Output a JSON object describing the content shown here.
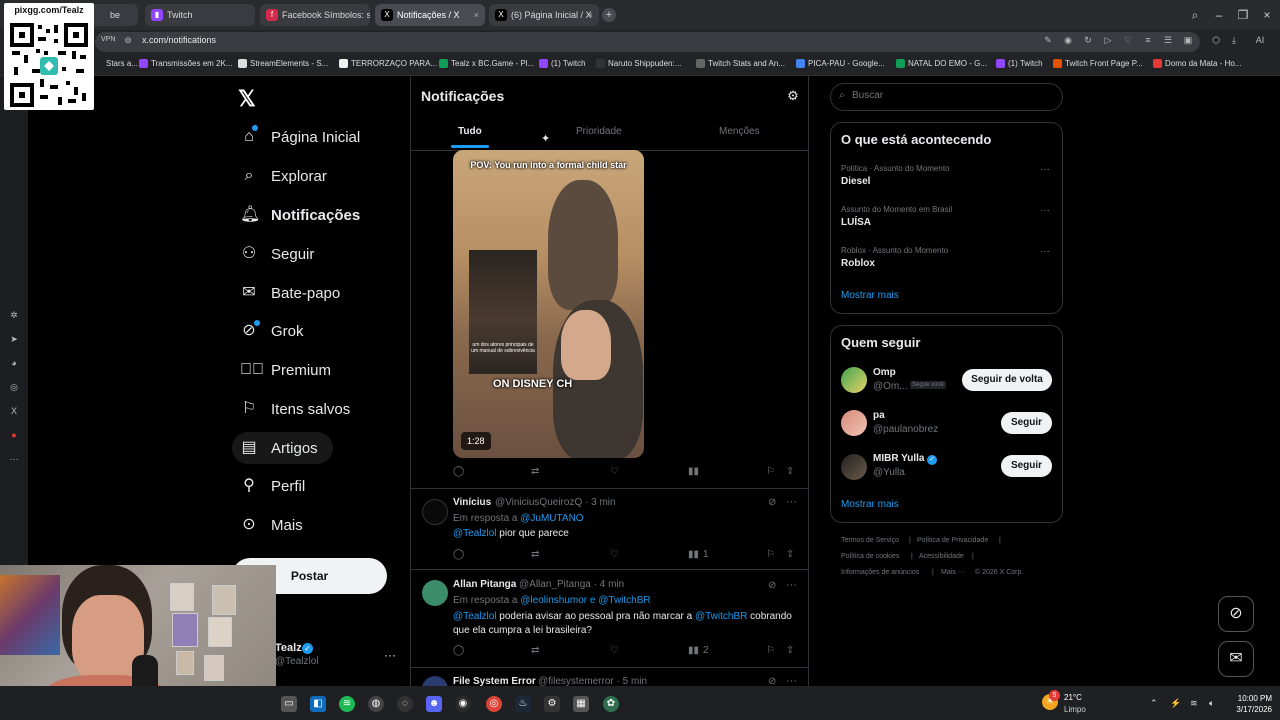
{
  "browser": {
    "tabs": [
      {
        "label": "be"
      },
      {
        "label": "Twitch"
      },
      {
        "label": "Facebook Símbolos: sím"
      },
      {
        "label": "Notificações / X"
      },
      {
        "label": "(6) Página Inicial / X"
      }
    ],
    "vpn_label": "VPN",
    "url": "x.com/notifications",
    "bookmarks": [
      {
        "label": "Stars a..."
      },
      {
        "label": "Transmissões em 2K..."
      },
      {
        "label": "StreamElements - S..."
      },
      {
        "label": "TERRORZAÇO PARA..."
      },
      {
        "label": "Tealz x BC.Game - Pl..."
      },
      {
        "label": "(1) Twitch"
      },
      {
        "label": "Naruto Shippuden:..."
      },
      {
        "label": "Twitch Stats and An..."
      },
      {
        "label": "PICA-PAU - Google..."
      },
      {
        "label": "NATAL DO EMO - G..."
      },
      {
        "label": "(1) Twitch"
      },
      {
        "label": "Twitch Front Page P..."
      },
      {
        "label": "Domo da Mata - Ho..."
      }
    ],
    "ai_label": "AI"
  },
  "overlay": {
    "qr_label": "pixgg.com/Tealz"
  },
  "sidebar": {
    "items": [
      {
        "label": "Página Inicial",
        "icon": "home-icon"
      },
      {
        "label": "Explorar",
        "icon": "search-icon"
      },
      {
        "label": "Notificações",
        "icon": "bell-icon"
      },
      {
        "label": "Seguir",
        "icon": "follow-icon"
      },
      {
        "label": "Bate-papo",
        "icon": "mail-icon"
      },
      {
        "label": "Grok",
        "icon": "grok-icon"
      },
      {
        "label": "Premium",
        "icon": "verified-icon"
      },
      {
        "label": "Itens salvos",
        "icon": "bookmark-icon"
      },
      {
        "label": "Artigos",
        "icon": "article-icon"
      },
      {
        "label": "Perfil",
        "icon": "person-icon"
      },
      {
        "label": "Mais",
        "icon": "more-circle-icon"
      }
    ],
    "post_label": "Postar",
    "account": {
      "name": "Tealz",
      "handle": "@Tealzlol"
    }
  },
  "main": {
    "title": "Notificações",
    "tabs": [
      {
        "label": "Tudo"
      },
      {
        "label": "Prioridade"
      },
      {
        "label": "Menções"
      }
    ],
    "video": {
      "caption": "POV: You run into a formal child star",
      "inset_caption": "um dos atores principais de um manual de sobrevivência",
      "overlay_text": "ON DISNEY CH",
      "duration": "1:28"
    },
    "tweets": [
      {
        "name": "Vinícius",
        "meta": "@ViniciusQueirozQ · 3 min",
        "reply_prefix": "Em resposta a",
        "reply_to": "@JuMUTANO",
        "mention": "@Tealzlol",
        "text": " pior que parece",
        "views": "1"
      },
      {
        "name": "Allan Pitanga",
        "meta": "@Allan_Pitanga · 4 min",
        "reply_prefix": "Em resposta a",
        "reply_to": "@leolinshumor e @TwitchBR",
        "mention": "@Tealzlol",
        "text_part1": " poderia avisar ao pessoal pra não marcar a ",
        "mention2": "@TwitchBR",
        "text_part2": " cobrando que ela cumpra a lei brasileira?",
        "views": "2"
      },
      {
        "name": "File System Error",
        "meta": "@filesystemerror · 5 min"
      }
    ]
  },
  "right": {
    "search_placeholder": "Buscar",
    "trending_title": "O que está acontecendo",
    "trends": [
      {
        "meta": "Política · Assunto do Momento",
        "name": "Diesel"
      },
      {
        "meta": "Assunto do Momento em Brasil",
        "name": "LUÍSA"
      },
      {
        "meta": "Roblox · Assunto do Momento",
        "name": "Roblox"
      }
    ],
    "show_more": "Mostrar mais",
    "who_title": "Quem seguir",
    "who": [
      {
        "name": "Omp",
        "handle": "@Om...",
        "badge": "Segue você",
        "button": "Seguir de volta"
      },
      {
        "name": "pa",
        "handle": "@paulanobrez",
        "button": "Seguir"
      },
      {
        "name": "MIBR Yulla",
        "handle": "@Yulla",
        "button": "Seguir"
      }
    ],
    "footer": [
      "Termos de Serviço",
      "|",
      "Política de Privacidade",
      "|",
      "Política de cookies",
      "|",
      "Acessibilidade",
      "|",
      "Informações de anúncios",
      "|",
      "Mais ···",
      "© 2026 X Corp."
    ]
  },
  "taskbar": {
    "weather_temp": "21°C",
    "weather_cond": "Limpo",
    "time": "10:00 PM",
    "date": "3/17/2026",
    "notif_count": "5"
  },
  "colors": {
    "accent": "#1d9bf0",
    "background": "#000000",
    "text": "#e7e9ea",
    "muted": "#71767b",
    "border": "#2f3336"
  }
}
